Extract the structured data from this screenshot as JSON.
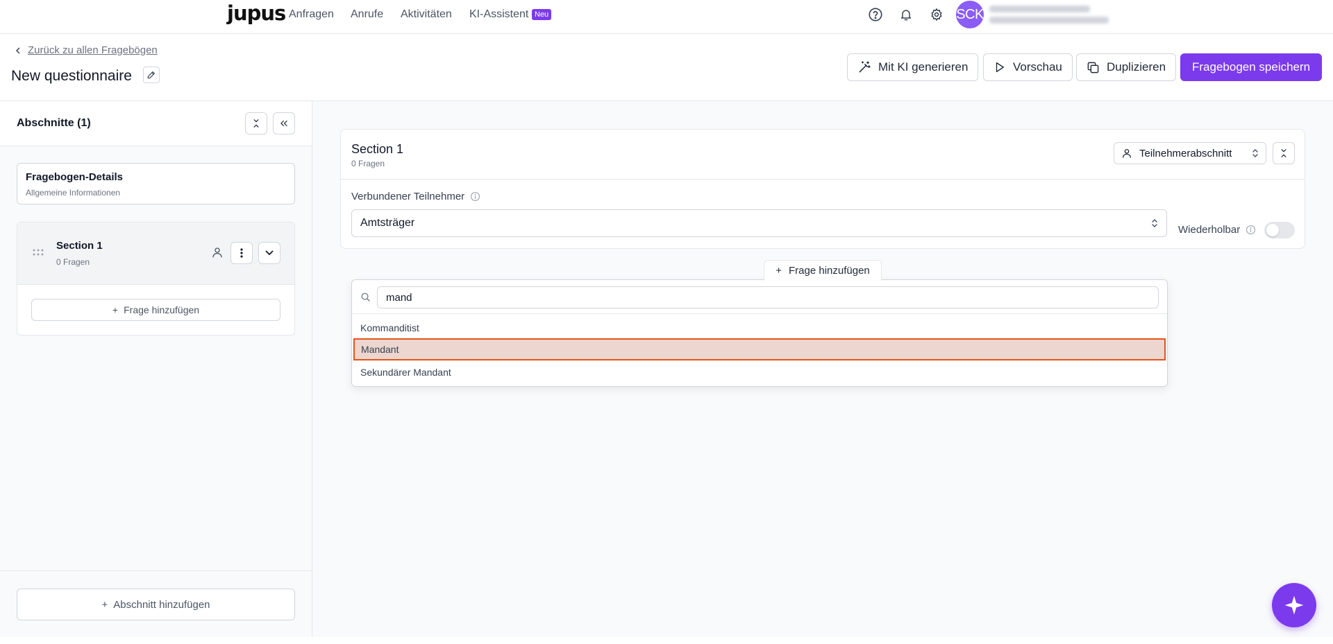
{
  "app": {
    "logo": "jupus"
  },
  "nav": {
    "items": [
      "Anfragen",
      "Anrufe",
      "Aktivitäten",
      "KI-Assistent"
    ],
    "new_badge": "Neu",
    "avatar_initials": "SCK"
  },
  "header": {
    "back_label": "Zurück zu allen Fragebögen",
    "title": "New questionnaire",
    "buttons": {
      "ai_generate": "Mit KI generieren",
      "preview": "Vorschau",
      "duplicate": "Duplizieren",
      "save": "Fragebogen speichern"
    }
  },
  "sidebar": {
    "title": "Abschnitte (1)",
    "details": {
      "title": "Fragebogen-Details",
      "subtitle": "Allgemeine Informationen"
    },
    "sections": [
      {
        "name": "Section 1",
        "count": "0 Fragen"
      }
    ],
    "add_question": "Frage hinzufügen",
    "add_section": "Abschnitt hinzufügen"
  },
  "main": {
    "section": {
      "title": "Section 1",
      "subtitle": "0 Fragen",
      "role_type": "Teilnehmerabschnitt",
      "participant_label": "Verbundener Teilnehmer",
      "participant_value": "Amtsträger",
      "repeatable_label": "Wiederholbar",
      "repeatable": false
    },
    "add_question": "Frage hinzufügen",
    "dropdown": {
      "search_value": "mand",
      "options": [
        "Kommanditist",
        "Mandant",
        "Sekundärer Mandant"
      ],
      "highlighted_index": 1
    }
  },
  "colors": {
    "accent": "#7c3aed",
    "highlight_bg": "#ecd6cf",
    "highlight_border": "#e2531c"
  }
}
